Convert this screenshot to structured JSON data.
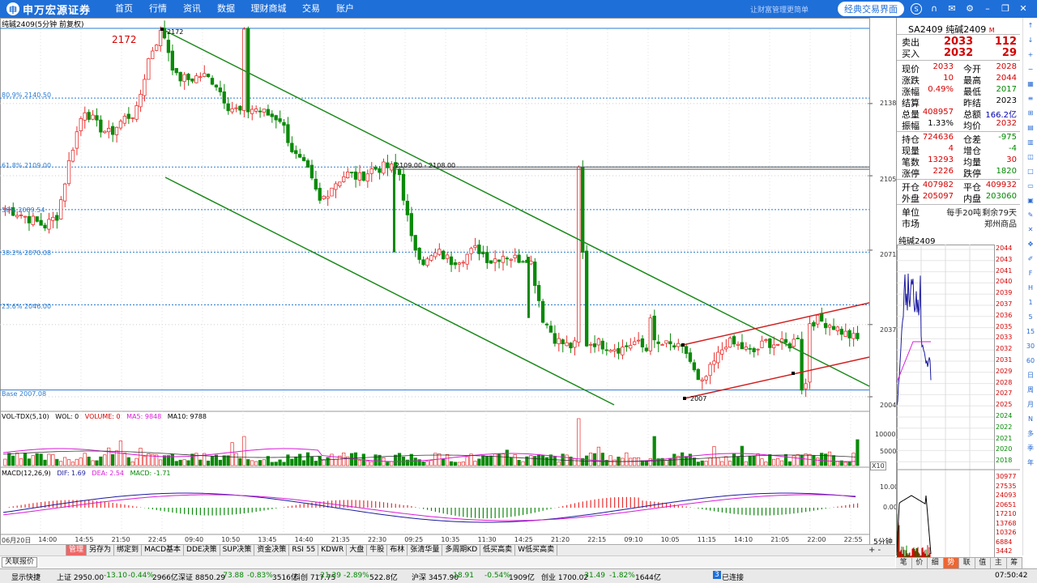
{
  "app": {
    "logo_mark": "申",
    "logo_text": "申万宏源证券",
    "nav": [
      "首页",
      "行情",
      "资讯",
      "数据",
      "理财商城",
      "交易",
      "账户"
    ],
    "slogan": "让财富管理更简单",
    "classic_button": "经典交易界面",
    "top_icons": [
      "sync-icon",
      "headset-icon",
      "mail-icon",
      "settings-icon",
      "minimize-icon",
      "restore-icon",
      "close-icon"
    ]
  },
  "chart": {
    "instrument_title": "纯碱2409(5分钟 前复权)",
    "high_label": "2172",
    "high_point_label": "2172",
    "low_point_label": "2007",
    "box_label": "2109.00 - 2108.00",
    "fib_labels": [
      "80.9% 2140.50",
      "61.8% 2109.00",
      "50% 2089.54",
      "38.2% 2070.08",
      "23.6% 2046.00",
      "Base 2007.08"
    ],
    "y_ticks": [
      "2138",
      "2105",
      "2071",
      "2037",
      "2004"
    ],
    "x_labels": [
      "06月20日",
      "14:00",
      "14:55",
      "21:50",
      "22:45",
      "09:40",
      "10:50",
      "13:45",
      "14:40",
      "21:35",
      "22:30",
      "09:25",
      "10:35",
      "11:30",
      "14:25",
      "21:20",
      "22:15",
      "09:10",
      "10:05",
      "11:15",
      "14:10",
      "21:05",
      "22:00",
      "22:55"
    ],
    "period_label": "5分钟",
    "vol": {
      "title": "VOL-TDX(5,10)",
      "wol": "WOL: 0",
      "volume": "VOLUME: 0",
      "ma5": "MA5: 9848",
      "ma10": "MA10: 9788",
      "ticks": [
        "10000",
        "5000"
      ],
      "unit": "X10"
    },
    "macd": {
      "title": "MACD(12,26,9)",
      "dif": "DIF: 1.69",
      "dea": "DEA: 2.54",
      "macd": "MACD: -1.71",
      "ticks": [
        "10.00",
        "0.00"
      ]
    },
    "colors": {
      "up": "#e8302f",
      "down": "#0a8a0a",
      "channel": "#1b8a1b",
      "fib": "#2a7bd1",
      "dif": "#1a1a9e",
      "dea": "#d81ad8"
    }
  },
  "chart_data": {
    "type": "candlestick",
    "instrument": "纯碱2409",
    "period": "5分钟",
    "price_range": [
      2004,
      2172
    ],
    "fib_levels": [
      2140.5,
      2109.0,
      2089.54,
      2070.08,
      2046.0,
      2007.08
    ],
    "key_points": {
      "high": 2172,
      "low": 2007,
      "box": [
        2109.0,
        2108.0
      ]
    },
    "close_path": [
      2090,
      2088,
      2085,
      2082,
      2087,
      2115,
      2136,
      2128,
      2124,
      2131,
      2134,
      2160,
      2172,
      2150,
      2149,
      2151,
      2148,
      2137,
      2134,
      2136,
      2133,
      2131,
      2115,
      2108,
      2093,
      2101,
      2106,
      2104,
      2108,
      2109,
      2108,
      2075,
      2065,
      2070,
      2066,
      2068,
      2072,
      2066,
      2069,
      2067,
      2068,
      2040,
      2030,
      2027,
      2028,
      2029,
      2027,
      2026,
      2029,
      2025,
      2028,
      2027,
      2024,
      2008,
      2019,
      2029,
      2027,
      2024,
      2029,
      2028,
      2028,
      2038,
      2039,
      2037,
      2033,
      2030
    ]
  },
  "panel": {
    "code": "SA2409 纯碱2409",
    "code_suffix": "M",
    "sell": {
      "label": "卖出",
      "price": "2033",
      "qty": "112"
    },
    "buy": {
      "label": "买入",
      "price": "2032",
      "qty": "29"
    },
    "rows": [
      [
        "现价",
        "2033",
        "今开",
        "2028"
      ],
      [
        "涨跌",
        "10",
        "最高",
        "2044"
      ],
      [
        "涨幅",
        "0.49%",
        "最低",
        "2017"
      ],
      [
        "结算",
        "",
        "昨结",
        "2023"
      ],
      [
        "总量",
        "408957",
        "总额",
        "166.2亿"
      ],
      [
        "振幅",
        "1.33%",
        "均价",
        "2032"
      ],
      [
        "持仓",
        "724636",
        "仓差",
        "-975"
      ],
      [
        "现量",
        "4",
        "增仓",
        "-4"
      ],
      [
        "笔数",
        "13293",
        "均量",
        "30"
      ],
      [
        "涨停",
        "2226",
        "跌停",
        "1820"
      ],
      [
        "开仓",
        "407982",
        "平仓",
        "409932"
      ],
      [
        "外盘",
        "205097",
        "内盘",
        "203060"
      ],
      [
        "单位",
        "每手20吨",
        "剩余79天",
        ""
      ],
      [
        "市场",
        "",
        "郑州商品",
        ""
      ]
    ],
    "mini_title": "纯碱2409",
    "mini_price_labels": [
      "2044",
      "2043",
      "2041",
      "2040",
      "2039",
      "2037",
      "2036",
      "2035",
      "2033",
      "2032",
      "2031",
      "2029",
      "2028",
      "2027",
      "2025",
      "2024",
      "2022",
      "2021",
      "2020",
      "2018"
    ],
    "mini_vol_labels": [
      "30977",
      "27535",
      "24093",
      "20651",
      "17210",
      "13768",
      "10326",
      "6884",
      "3442"
    ],
    "tabs": [
      "笔",
      "价",
      "细",
      "势",
      "联",
      "值",
      "主",
      "筹"
    ],
    "active_tab": "势"
  },
  "tools": [
    "arrow-up-icon",
    "arrow-down-icon",
    "zoom-in-icon",
    "zoom-out-icon",
    "grid-icon",
    "list-icon",
    "tile-icon",
    "chart-icon",
    "layout-icon",
    "layers-icon",
    "window-icon",
    "bars-icon",
    "window2-icon",
    "pen-icon",
    "cross-icon",
    "move-icon",
    "edit-icon",
    "f-icon",
    "h-icon",
    "1-icon",
    "5-icon",
    "15-icon",
    "30-icon",
    "60-icon",
    "d-icon",
    "w-icon",
    "m-icon",
    "n-icon",
    "duo-icon",
    "ji-icon",
    "nian-icon"
  ],
  "tool_labels": [
    "↑",
    "↓",
    "+",
    "−",
    "▦",
    "≡",
    "⊞",
    "▤",
    "▥",
    "◫",
    "□",
    "▭",
    "▣",
    "✎",
    "✕",
    "✥",
    "✐",
    "F",
    "H",
    "1",
    "5",
    "15",
    "30",
    "60",
    "日",
    "周",
    "月",
    "N",
    "多",
    "季",
    "年"
  ],
  "bottom_tabs": [
    "管理",
    "另存为",
    "绑定到",
    "MACD基本",
    "DDE决策",
    "SUP决策",
    "资金决策",
    "RSI 55",
    "KDWR",
    "大盘",
    "牛股",
    "布林",
    "张清华量",
    "多周期KD",
    "低买高卖",
    "W低买高卖"
  ],
  "active_bottom_tab": "管理",
  "pm": "+  -",
  "related": "关联报价",
  "status": [
    {
      "t": "显示快捷",
      "c": "#000"
    },
    {
      "t": "上证 2950.00",
      "c": "#000"
    },
    {
      "t": "-13.10",
      "c": "#080"
    },
    {
      "t": "-0.44%",
      "c": "#080"
    },
    {
      "t": "2966亿",
      "c": "#000"
    },
    {
      "t": "深证 8850.29",
      "c": "#000"
    },
    {
      "t": "-73.88",
      "c": "#080"
    },
    {
      "t": "-0.83%",
      "c": "#080"
    },
    {
      "t": "3516亿",
      "c": "#000"
    },
    {
      "t": "科创 717.75",
      "c": "#000"
    },
    {
      "t": "-21.39",
      "c": "#080"
    },
    {
      "t": "-2.89%",
      "c": "#080"
    },
    {
      "t": "522.8亿",
      "c": "#000"
    },
    {
      "t": "沪深 3457.90",
      "c": "#000"
    },
    {
      "t": "-18.91",
      "c": "#080"
    },
    {
      "t": "-0.54%",
      "c": "#080"
    },
    {
      "t": "1909亿",
      "c": "#000"
    },
    {
      "t": "创业 1700.02",
      "c": "#000"
    },
    {
      "t": "-31.49",
      "c": "#080"
    },
    {
      "t": "-1.82%",
      "c": "#080"
    },
    {
      "t": "1644亿",
      "c": "#000"
    },
    {
      "t": "3",
      "c": "#fff"
    },
    {
      "t": "已连接",
      "c": "#000"
    },
    {
      "t": "07:50:42",
      "c": "#000"
    }
  ]
}
